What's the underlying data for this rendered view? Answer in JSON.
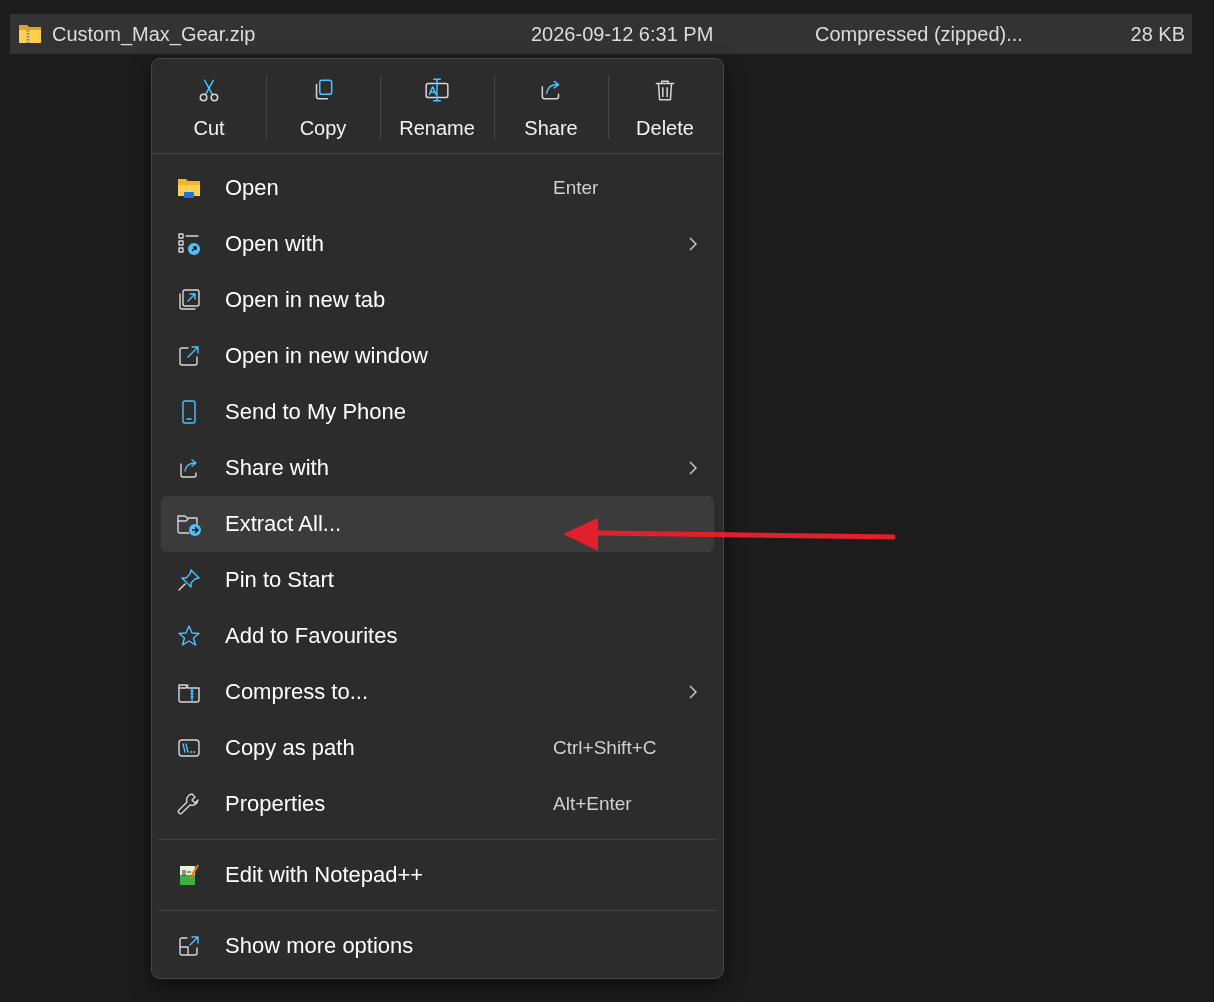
{
  "file_row": {
    "name": "Custom_Max_Gear.zip",
    "date_modified": "2026-09-12 6:31 PM",
    "type": "Compressed (zipped)...",
    "size": "28 KB",
    "selected": true
  },
  "context_menu": {
    "toolbar": [
      {
        "label": "Cut"
      },
      {
        "label": "Copy"
      },
      {
        "label": "Rename"
      },
      {
        "label": "Share"
      },
      {
        "label": "Delete"
      }
    ],
    "sections": [
      [
        {
          "label": "Open",
          "shortcut": "Enter",
          "submenu": false,
          "selected": false
        },
        {
          "label": "Open with",
          "submenu": true,
          "selected": false
        },
        {
          "label": "Open in new tab",
          "submenu": false,
          "selected": false
        },
        {
          "label": "Open in new window",
          "submenu": false,
          "selected": false
        },
        {
          "label": "Send to My Phone",
          "submenu": false,
          "selected": false
        },
        {
          "label": "Share with",
          "submenu": true,
          "selected": false
        },
        {
          "label": "Extract All...",
          "submenu": false,
          "selected": true
        },
        {
          "label": "Pin to Start",
          "submenu": false,
          "selected": false
        },
        {
          "label": "Add to Favourites",
          "submenu": false,
          "selected": false
        },
        {
          "label": "Compress to...",
          "submenu": true,
          "selected": false
        },
        {
          "label": "Copy as path",
          "shortcut": "Ctrl+Shift+C",
          "submenu": false,
          "selected": false
        },
        {
          "label": "Properties",
          "shortcut": "Alt+Enter",
          "submenu": false,
          "selected": false
        }
      ],
      [
        {
          "label": "Edit with Notepad++",
          "submenu": false,
          "selected": false
        }
      ],
      [
        {
          "label": "Show more options",
          "submenu": false,
          "selected": false
        }
      ]
    ]
  }
}
